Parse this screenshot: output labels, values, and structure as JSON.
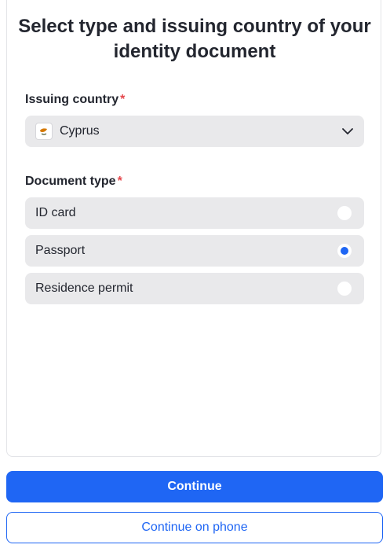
{
  "title": "Select type and issuing country of your identity document",
  "country_field": {
    "label": "Issuing country",
    "required_mark": "*",
    "selected_value": "Cyprus",
    "flag_icon": "cyprus-flag-icon"
  },
  "document_field": {
    "label": "Document type",
    "required_mark": "*",
    "options": [
      {
        "label": "ID card",
        "selected": false
      },
      {
        "label": "Passport",
        "selected": true
      },
      {
        "label": "Residence permit",
        "selected": false
      }
    ]
  },
  "buttons": {
    "continue_label": "Continue",
    "continue_on_phone_label": "Continue on phone"
  },
  "colors": {
    "accent": "#1f66f4",
    "required": "#e5484d",
    "field_background": "#e9e9eb"
  }
}
